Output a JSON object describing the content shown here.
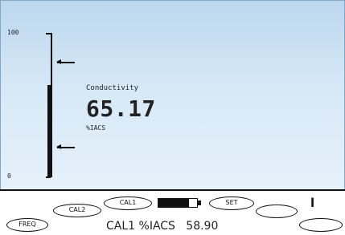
{
  "scale": {
    "max_label": "100",
    "min_label": "0",
    "fill_fraction": 0.64,
    "upper_arrow_fraction": 0.8,
    "lower_arrow_fraction": 0.21
  },
  "reading": {
    "label": "Conductivity",
    "value": "65.17",
    "unit": "%IACS"
  },
  "softkeys": {
    "freq": "FREQ",
    "cal2": "CAL2",
    "cal1": "CAL1",
    "set": "SET",
    "blank1": "",
    "blank2": ""
  },
  "battery": {
    "level_fraction": 0.8
  },
  "status_icon": "ꞁ",
  "status": {
    "mode": "CAL1 %IACS",
    "value": "58.90"
  }
}
